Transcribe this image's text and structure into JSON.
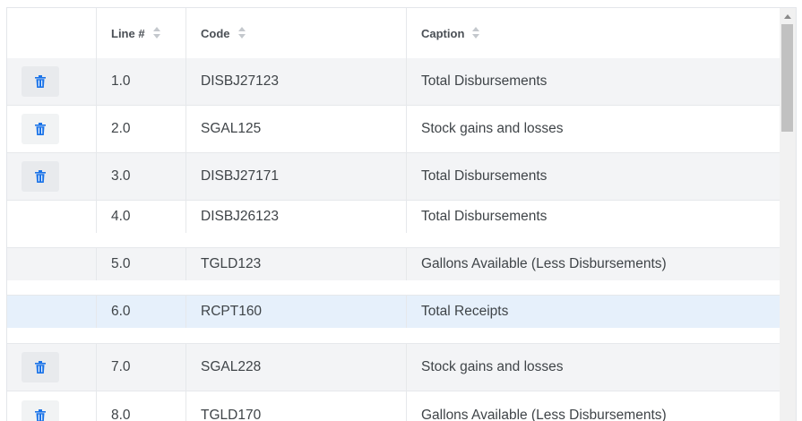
{
  "grid": {
    "columns": [
      {
        "key": "actions",
        "label": ""
      },
      {
        "key": "line",
        "label": "Line #"
      },
      {
        "key": "code",
        "label": "Code"
      },
      {
        "key": "caption",
        "label": "Caption"
      }
    ],
    "rows": [
      {
        "line": "1.0",
        "code": "DISBJ27123",
        "caption": "Total Disbursements",
        "has_delete": true,
        "selected": false
      },
      {
        "line": "2.0",
        "code": "SGAL125",
        "caption": "Stock gains and losses",
        "has_delete": true,
        "selected": false
      },
      {
        "line": "3.0",
        "code": "DISBJ27171",
        "caption": "Total Disbursements",
        "has_delete": true,
        "selected": false
      },
      {
        "line": "4.0",
        "code": "DISBJ26123",
        "caption": "Total Disbursements",
        "has_delete": false,
        "selected": false
      },
      {
        "line": "5.0",
        "code": "TGLD123",
        "caption": "Gallons Available (Less Disbursements)",
        "has_delete": false,
        "selected": false
      },
      {
        "line": "6.0",
        "code": "RCPT160",
        "caption": "Total Receipts",
        "has_delete": false,
        "selected": true
      },
      {
        "line": "7.0",
        "code": "SGAL228",
        "caption": "Stock gains and losses",
        "has_delete": true,
        "selected": false
      },
      {
        "line": "8.0",
        "code": "TGLD170",
        "caption": "Gallons Available (Less Disbursements)",
        "has_delete": true,
        "selected": false
      }
    ]
  },
  "icons": {
    "delete": "trash-icon",
    "sort": "sort-icon"
  },
  "colors": {
    "accent": "#1a73e8",
    "selected_row": "#e6f0fb",
    "shaded_row": "#f3f4f6"
  }
}
